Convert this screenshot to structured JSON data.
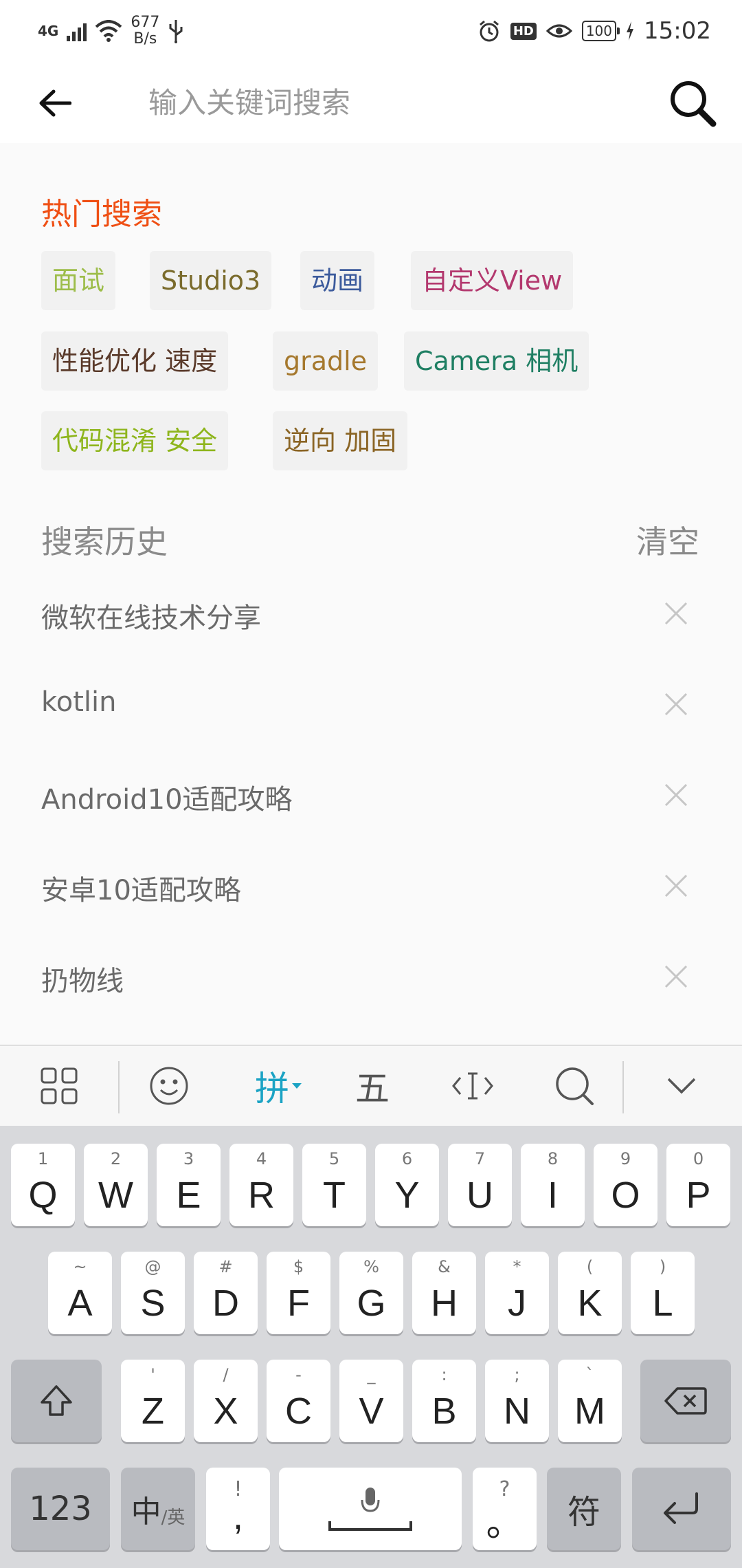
{
  "status_bar": {
    "network": "4G",
    "speed_value": "677",
    "speed_unit": "B/s",
    "battery": "100",
    "time": "15:02",
    "hd_label": "HD"
  },
  "header": {
    "search_placeholder": "输入关键词搜索"
  },
  "hot_search": {
    "title": "热门搜索",
    "title_color": "#ef4f14",
    "tags": [
      {
        "label": "面试",
        "color": "#9dbd4a"
      },
      {
        "label": "Studio3",
        "color": "#7a6b2c"
      },
      {
        "label": "动画",
        "color": "#3b5a9c"
      },
      {
        "label": "自定义View",
        "color": "#b3386e"
      },
      {
        "label": "性能优化 速度",
        "color": "#5a3a2a"
      },
      {
        "label": "gradle",
        "color": "#a5782d"
      },
      {
        "label": "Camera 相机",
        "color": "#1f7f63"
      },
      {
        "label": "代码混淆 安全",
        "color": "#8eb51c"
      },
      {
        "label": "逆向 加固",
        "color": "#8a6424"
      }
    ]
  },
  "history": {
    "title": "搜索历史",
    "clear_label": "清空",
    "items": [
      {
        "label": "微软在线技术分享"
      },
      {
        "label": "kotlin"
      },
      {
        "label": "Android10适配攻略"
      },
      {
        "label": "安卓10适配攻略"
      },
      {
        "label": "扔物线"
      }
    ]
  },
  "keyboard_toolbar": {
    "pinyin_label": "拼",
    "wubi_label": "五",
    "accent_color": "#1ba3c4"
  },
  "keyboard": {
    "row1": [
      {
        "main": "Q",
        "sub": "1"
      },
      {
        "main": "W",
        "sub": "2"
      },
      {
        "main": "E",
        "sub": "3"
      },
      {
        "main": "R",
        "sub": "4"
      },
      {
        "main": "T",
        "sub": "5"
      },
      {
        "main": "Y",
        "sub": "6"
      },
      {
        "main": "U",
        "sub": "7"
      },
      {
        "main": "I",
        "sub": "8"
      },
      {
        "main": "O",
        "sub": "9"
      },
      {
        "main": "P",
        "sub": "0"
      }
    ],
    "row2": [
      {
        "main": "A",
        "sub": "~"
      },
      {
        "main": "S",
        "sub": "@"
      },
      {
        "main": "D",
        "sub": "#"
      },
      {
        "main": "F",
        "sub": "$"
      },
      {
        "main": "G",
        "sub": "%"
      },
      {
        "main": "H",
        "sub": "&"
      },
      {
        "main": "J",
        "sub": "*"
      },
      {
        "main": "K",
        "sub": "("
      },
      {
        "main": "L",
        "sub": ")"
      }
    ],
    "row3": [
      {
        "main": "Z",
        "sub": "'"
      },
      {
        "main": "X",
        "sub": "/"
      },
      {
        "main": "C",
        "sub": "-"
      },
      {
        "main": "V",
        "sub": "_"
      },
      {
        "main": "B",
        "sub": ":"
      },
      {
        "main": "N",
        "sub": ";"
      },
      {
        "main": "M",
        "sub": "`"
      }
    ],
    "num_label": "123",
    "lang_main": "中",
    "lang_sub": "/英",
    "comma_main": ",",
    "comma_sub": "!",
    "period_main": "。",
    "period_sub": "?",
    "symbol_label": "符"
  }
}
